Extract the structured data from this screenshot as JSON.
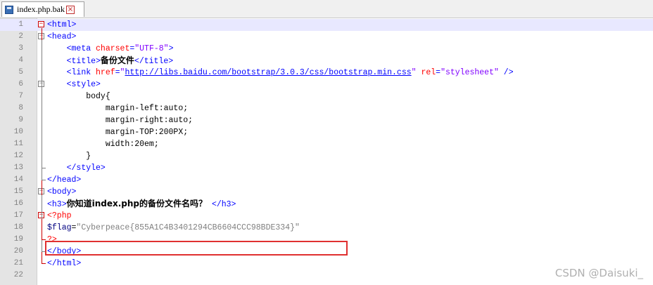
{
  "tab": {
    "title": "index.php.bak",
    "save_icon": "save-icon",
    "close_icon": "close-icon"
  },
  "lines": [
    {
      "n": "1",
      "segments": [
        {
          "c": "tag",
          "t": "<html>"
        }
      ]
    },
    {
      "n": "2",
      "segments": [
        {
          "c": "tag",
          "t": "<head>"
        }
      ]
    },
    {
      "n": "3",
      "segments": [
        {
          "c": "css",
          "t": "    "
        },
        {
          "c": "tag",
          "t": "<meta "
        },
        {
          "c": "attr",
          "t": "charset"
        },
        {
          "c": "tag",
          "t": "="
        },
        {
          "c": "str",
          "t": "\"UTF-8\""
        },
        {
          "c": "tag",
          "t": ">"
        }
      ]
    },
    {
      "n": "4",
      "segments": [
        {
          "c": "css",
          "t": "    "
        },
        {
          "c": "tag",
          "t": "<title>"
        },
        {
          "c": "txt",
          "t": "备份文件"
        },
        {
          "c": "tag",
          "t": "</title>"
        }
      ]
    },
    {
      "n": "5",
      "segments": [
        {
          "c": "css",
          "t": "    "
        },
        {
          "c": "tag",
          "t": "<link "
        },
        {
          "c": "attr",
          "t": "href"
        },
        {
          "c": "tag",
          "t": "="
        },
        {
          "c": "str",
          "t": "\""
        },
        {
          "c": "link",
          "t": "http://libs.baidu.com/bootstrap/3.0.3/css/bootstrap.min.css"
        },
        {
          "c": "str",
          "t": "\""
        },
        {
          "c": "css",
          "t": " "
        },
        {
          "c": "attr",
          "t": "rel"
        },
        {
          "c": "tag",
          "t": "="
        },
        {
          "c": "str",
          "t": "\"stylesheet\""
        },
        {
          "c": "css",
          "t": " "
        },
        {
          "c": "tag",
          "t": "/>"
        }
      ]
    },
    {
      "n": "6",
      "segments": [
        {
          "c": "css",
          "t": "    "
        },
        {
          "c": "tag",
          "t": "<style>"
        }
      ]
    },
    {
      "n": "7",
      "segments": [
        {
          "c": "css",
          "t": "        body{"
        }
      ]
    },
    {
      "n": "8",
      "segments": [
        {
          "c": "css",
          "t": "            margin-left:auto;"
        }
      ]
    },
    {
      "n": "9",
      "segments": [
        {
          "c": "css",
          "t": "            margin-right:auto;"
        }
      ]
    },
    {
      "n": "10",
      "segments": [
        {
          "c": "css",
          "t": "            margin-TOP:200PX;"
        }
      ]
    },
    {
      "n": "11",
      "segments": [
        {
          "c": "css",
          "t": "            width:20em;"
        }
      ]
    },
    {
      "n": "12",
      "segments": [
        {
          "c": "css",
          "t": "        }"
        }
      ]
    },
    {
      "n": "13",
      "segments": [
        {
          "c": "css",
          "t": "    "
        },
        {
          "c": "tag",
          "t": "</style>"
        }
      ]
    },
    {
      "n": "14",
      "segments": [
        {
          "c": "tag",
          "t": "</head>"
        }
      ]
    },
    {
      "n": "15",
      "segments": [
        {
          "c": "tag",
          "t": "<body>"
        }
      ]
    },
    {
      "n": "16",
      "segments": [
        {
          "c": "tag",
          "t": "<h3>"
        },
        {
          "c": "txt",
          "t": "你知道index.php的备份文件名吗？"
        },
        {
          "c": "css",
          "t": " "
        },
        {
          "c": "tag",
          "t": "</h3>"
        }
      ]
    },
    {
      "n": "17",
      "segments": [
        {
          "c": "php",
          "t": "<?php"
        }
      ]
    },
    {
      "n": "18",
      "segments": [
        {
          "c": "var",
          "t": "$flag"
        },
        {
          "c": "css",
          "t": "="
        },
        {
          "c": "pstr",
          "t": "\"Cyberpeace{855A1C4B3401294CB6604CCC98BDE334}\""
        }
      ]
    },
    {
      "n": "19",
      "segments": [
        {
          "c": "php",
          "t": "?>"
        }
      ]
    },
    {
      "n": "20",
      "segments": [
        {
          "c": "tag",
          "t": "</body>"
        }
      ]
    },
    {
      "n": "21",
      "segments": [
        {
          "c": "tag",
          "t": "</html>"
        }
      ]
    },
    {
      "n": "22",
      "segments": []
    }
  ],
  "watermark": "CSDN @Daisuki_"
}
